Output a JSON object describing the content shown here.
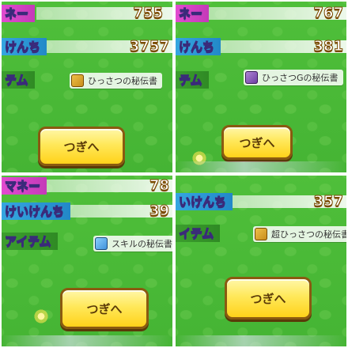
{
  "panels": [
    {
      "money_label": "ネー",
      "money_value": "755",
      "exp_label": "けんち",
      "exp_value": "3757",
      "item_label": "テム",
      "item_name": "ひっさつの秘伝書",
      "item_icon": "scroll-gold-icon",
      "next_label": "つぎへ"
    },
    {
      "money_label": "ネー",
      "money_value": "767",
      "exp_label": "けんち",
      "exp_value": "381",
      "item_label": "テム",
      "item_name": "ひっさつGの秘伝書",
      "item_icon": "scroll-purple-icon",
      "next_label": "つぎへ"
    },
    {
      "money_label": "マネー",
      "money_value": "78",
      "exp_label": "けいけんち",
      "exp_value": "39",
      "item_label": "アイテム",
      "item_name": "スキルの秘伝書",
      "item_icon": "scroll-blue-icon",
      "next_label": "つぎへ"
    },
    {
      "money_label": "",
      "money_value": "",
      "exp_label": "いけんち",
      "exp_value": "357",
      "item_label": "イテム",
      "item_name": "超ひっさつの秘伝書",
      "item_icon": "scroll-gold-icon",
      "next_label": "つぎへ"
    }
  ],
  "colors": {
    "background_green": "#45b434",
    "button_yellow": "#ffd21a",
    "button_border": "#8a5a10",
    "money_pink": "#e24bd0",
    "exp_blue": "#35a6e0"
  }
}
